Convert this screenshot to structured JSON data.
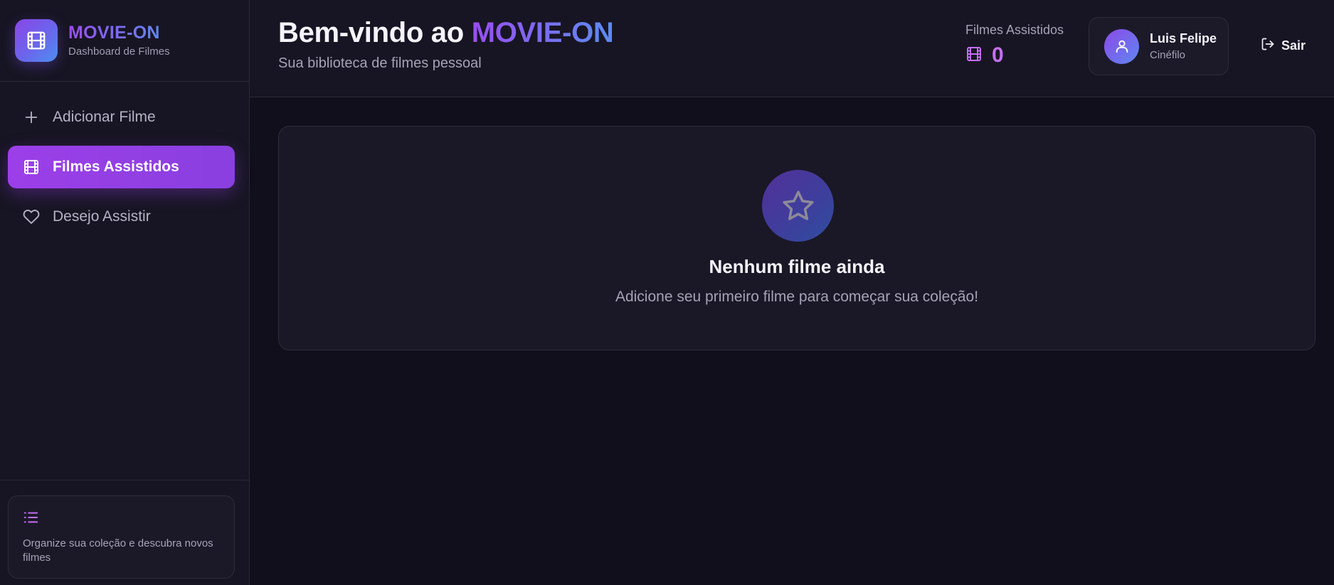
{
  "brand": {
    "title": "MOVIE-ON",
    "subtitle": "Dashboard de Filmes",
    "icon": "film-icon"
  },
  "sidebar": {
    "items": [
      {
        "label": "Adicionar Filme",
        "icon": "plus-icon",
        "active": false
      },
      {
        "label": "Filmes Assistidos",
        "icon": "film-icon",
        "active": true
      },
      {
        "label": "Desejo Assistir",
        "icon": "heart-icon",
        "active": false
      }
    ],
    "tip": {
      "icon": "list-icon",
      "text": "Organize sua coleção e descubra novos filmes"
    }
  },
  "header": {
    "welcome_prefix": "Bem-vindo ao ",
    "welcome_brand": "MOVIE-ON",
    "subtitle": "Sua biblioteca de filmes pessoal",
    "stat": {
      "label": "Filmes Assistidos",
      "value": "0",
      "icon": "film-icon"
    },
    "user": {
      "name": "Luis Felipe",
      "role": "Cinéfilo",
      "icon": "user-icon"
    },
    "logout_label": "Sair"
  },
  "main": {
    "empty_state": {
      "icon": "star-icon",
      "title": "Nenhum filme ainda",
      "message": "Adicione seu primeiro filme para começar sua coleção!"
    }
  },
  "colors": {
    "background": "#110f1b",
    "panel": "#171523",
    "accent_purple": "#9a4ef0",
    "accent_blue": "#5b8cf0",
    "active_nav": "#9c3fe8",
    "stat_value": "#c46ff5"
  }
}
